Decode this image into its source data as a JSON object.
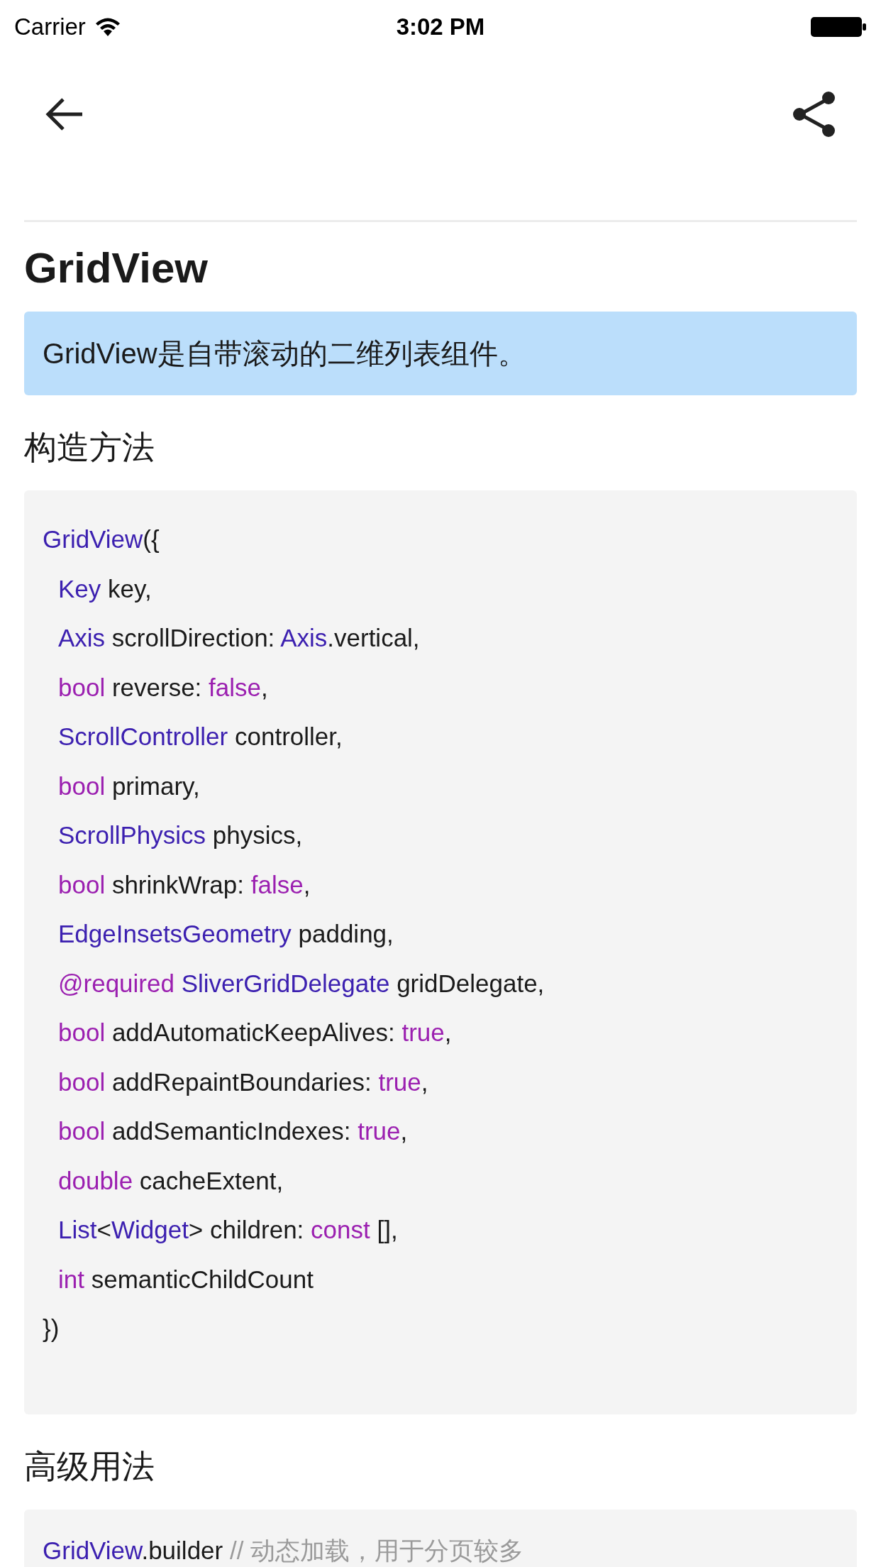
{
  "status_bar": {
    "carrier": "Carrier",
    "time": "3:02 PM"
  },
  "title": "GridView",
  "summary": "GridView是自带滚动的二维列表组件。",
  "sections": [
    {
      "heading": "构造方法",
      "code": [
        {
          "tokens": [
            {
              "kind": "type",
              "text": "GridView"
            },
            {
              "kind": "plain",
              "text": "({"
            }
          ],
          "children": [
            {
              "tokens": [
                {
                  "kind": "type",
                  "text": "Key"
                },
                {
                  "kind": "plain",
                  "text": " key,"
                }
              ]
            },
            {
              "tokens": [
                {
                  "kind": "type",
                  "text": "Axis"
                },
                {
                  "kind": "plain",
                  "text": " scrollDirection: "
                },
                {
                  "kind": "type",
                  "text": "Axis"
                },
                {
                  "kind": "plain",
                  "text": ".vertical,"
                }
              ]
            },
            {
              "tokens": [
                {
                  "kind": "keyword",
                  "text": "bool"
                },
                {
                  "kind": "plain",
                  "text": " reverse: "
                },
                {
                  "kind": "keyword",
                  "text": "false"
                },
                {
                  "kind": "plain",
                  "text": ","
                }
              ]
            },
            {
              "tokens": [
                {
                  "kind": "type",
                  "text": "ScrollController"
                },
                {
                  "kind": "plain",
                  "text": " controller,"
                }
              ]
            },
            {
              "tokens": [
                {
                  "kind": "keyword",
                  "text": "bool"
                },
                {
                  "kind": "plain",
                  "text": " primary,"
                }
              ]
            },
            {
              "tokens": [
                {
                  "kind": "type",
                  "text": "ScrollPhysics"
                },
                {
                  "kind": "plain",
                  "text": " physics,"
                }
              ]
            },
            {
              "tokens": [
                {
                  "kind": "keyword",
                  "text": "bool"
                },
                {
                  "kind": "plain",
                  "text": " shrinkWrap: "
                },
                {
                  "kind": "keyword",
                  "text": "false"
                },
                {
                  "kind": "plain",
                  "text": ","
                }
              ]
            },
            {
              "tokens": [
                {
                  "kind": "type",
                  "text": "EdgeInsetsGeometry"
                },
                {
                  "kind": "plain",
                  "text": " padding,"
                }
              ]
            },
            {
              "tokens": [
                {
                  "kind": "keyword",
                  "text": "@required "
                },
                {
                  "kind": "type",
                  "text": "SliverGridDelegate"
                },
                {
                  "kind": "plain",
                  "text": " gridDelegate,"
                }
              ]
            },
            {
              "tokens": [
                {
                  "kind": "keyword",
                  "text": "bool"
                },
                {
                  "kind": "plain",
                  "text": " addAutomaticKeepAlives: "
                },
                {
                  "kind": "keyword",
                  "text": "true"
                },
                {
                  "kind": "plain",
                  "text": ","
                }
              ]
            },
            {
              "tokens": [
                {
                  "kind": "keyword",
                  "text": "bool"
                },
                {
                  "kind": "plain",
                  "text": " addRepaintBoundaries: "
                },
                {
                  "kind": "keyword",
                  "text": "true"
                },
                {
                  "kind": "plain",
                  "text": ","
                }
              ]
            },
            {
              "tokens": [
                {
                  "kind": "keyword",
                  "text": "bool"
                },
                {
                  "kind": "plain",
                  "text": " addSemanticIndexes: "
                },
                {
                  "kind": "keyword",
                  "text": "true"
                },
                {
                  "kind": "plain",
                  "text": ","
                }
              ]
            },
            {
              "tokens": [
                {
                  "kind": "keyword",
                  "text": "double"
                },
                {
                  "kind": "plain",
                  "text": " cacheExtent,"
                }
              ]
            },
            {
              "tokens": [
                {
                  "kind": "type",
                  "text": "List"
                },
                {
                  "kind": "plain",
                  "text": "<"
                },
                {
                  "kind": "type",
                  "text": "Widget"
                },
                {
                  "kind": "plain",
                  "text": "> children: "
                },
                {
                  "kind": "keyword",
                  "text": "const"
                },
                {
                  "kind": "plain",
                  "text": " [],"
                }
              ]
            },
            {
              "tokens": [
                {
                  "kind": "keyword",
                  "text": "int"
                },
                {
                  "kind": "plain",
                  "text": " semanticChildCount"
                }
              ]
            }
          ]
        },
        {
          "tokens": [
            {
              "kind": "plain",
              "text": "})"
            }
          ]
        }
      ]
    },
    {
      "heading": "高级用法",
      "code": [
        {
          "tokens": [
            {
              "kind": "type",
              "text": "GridView"
            },
            {
              "kind": "plain",
              "text": ".builder "
            },
            {
              "kind": "comment",
              "text": "// 动态加载，用于分页较多"
            }
          ]
        }
      ]
    }
  ]
}
